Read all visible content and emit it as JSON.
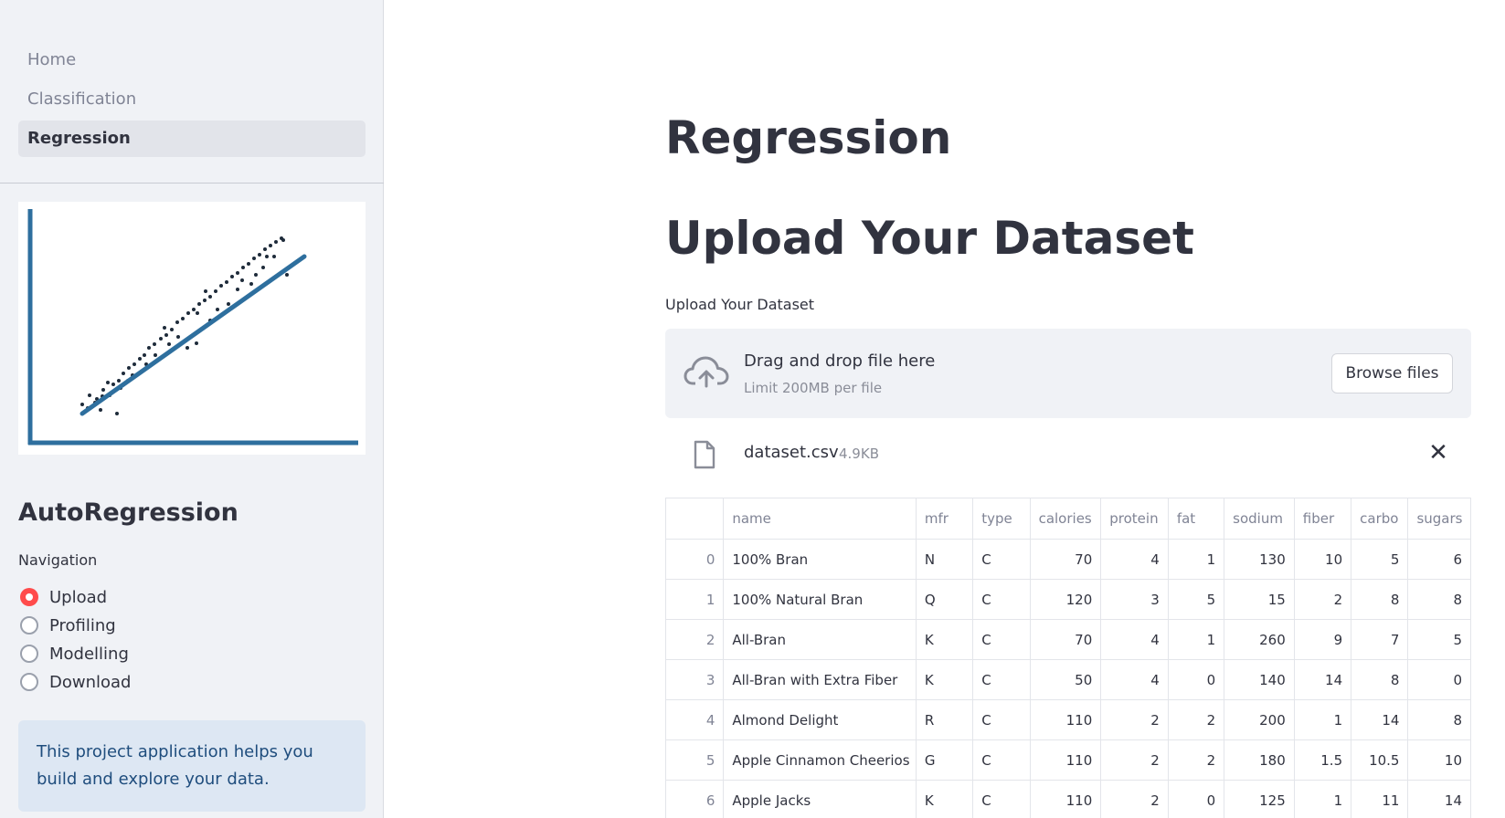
{
  "sidebar": {
    "pages": [
      {
        "label": "Home",
        "active": false
      },
      {
        "label": "Classification",
        "active": false
      },
      {
        "label": "Regression",
        "active": true
      }
    ],
    "app_title": "AutoRegression",
    "navigation_label": "Navigation",
    "radio_options": [
      {
        "label": "Upload",
        "selected": true
      },
      {
        "label": "Profiling",
        "selected": false
      },
      {
        "label": "Modelling",
        "selected": false
      },
      {
        "label": "Download",
        "selected": false
      }
    ],
    "info_text": "This project application helps you build and explore your data.",
    "image_icon": "regression-scatter-plot-illustration"
  },
  "main": {
    "page_title": "Regression",
    "section_title": "Upload Your Dataset",
    "uploader": {
      "label": "Upload Your Dataset",
      "drop_text": "Drag and drop file here",
      "limit_text": "Limit 200MB per file",
      "browse_label": "Browse files",
      "icon": "cloud-upload-icon"
    },
    "uploaded_file": {
      "name": "dataset.csv",
      "size": "4.9KB",
      "icon": "file-icon",
      "close_icon": "close-icon"
    },
    "table": {
      "columns": [
        "",
        "name",
        "mfr",
        "type",
        "calories",
        "protein",
        "fat",
        "sodium",
        "fiber",
        "carbo",
        "sugars"
      ],
      "rows": [
        [
          "0",
          "100% Bran",
          "N",
          "C",
          "70",
          "4",
          "1",
          "130",
          "10",
          "5",
          "6"
        ],
        [
          "1",
          "100% Natural Bran",
          "Q",
          "C",
          "120",
          "3",
          "5",
          "15",
          "2",
          "8",
          "8"
        ],
        [
          "2",
          "All-Bran",
          "K",
          "C",
          "70",
          "4",
          "1",
          "260",
          "9",
          "7",
          "5"
        ],
        [
          "3",
          "All-Bran with Extra Fiber",
          "K",
          "C",
          "50",
          "4",
          "0",
          "140",
          "14",
          "8",
          "0"
        ],
        [
          "4",
          "Almond Delight",
          "R",
          "C",
          "110",
          "2",
          "2",
          "200",
          "1",
          "14",
          "8"
        ],
        [
          "5",
          "Apple Cinnamon Cheerios",
          "G",
          "C",
          "110",
          "2",
          "2",
          "180",
          "1.5",
          "10.5",
          "10"
        ],
        [
          "6",
          "Apple Jacks",
          "K",
          "C",
          "110",
          "2",
          "0",
          "125",
          "1",
          "11",
          "14"
        ]
      ]
    }
  },
  "colors": {
    "sidebar_bg": "#f0f2f6",
    "accent_radio": "#ff4b4b",
    "info_bg": "#dde7f3",
    "info_text": "#1f4d7d",
    "plot_line": "#2e6f9e"
  }
}
